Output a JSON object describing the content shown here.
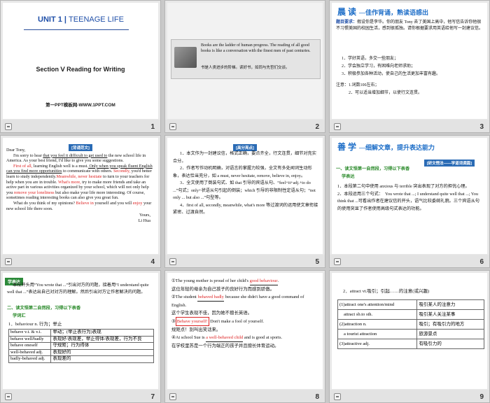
{
  "slides": [
    {
      "number": "1",
      "unit": "UNIT 1",
      "unit_title": "TEENAGE LIFE",
      "section": "Section Ⅴ Reading for Writing",
      "footer": "第一PPT模板网-WWW.1PPT.COM"
    },
    {
      "number": "2",
      "quote_en": "Books are the ladder of human progress. The reading of all good books is like a conversation with the finest men of past centuries.",
      "quote_cn": "书是人类进步的阶梯。读好书，如同与先哲们交谈。"
    },
    {
      "number": "3",
      "title_main": "晨 读",
      "title_sub": "—佳作背诵，熟读语感出",
      "task_label": "题目要求：",
      "task": "假设你是李华。你的朋友 Tony 去了美国上高中，他写信告诉你他很不习惯美国的校园生活，感到很孤独。请你根据要求用英语给他写一封建议信。",
      "points": [
        "1．学好英语，多交一些朋友；",
        "2．学会独立学习，有困难向老师求助；",
        "3．积极参加各种活动，使自己的生活更加丰富有趣。"
      ],
      "notes": [
        "注意：1.词数100左右；",
        "2．可以适当增加细节，以使行文连贯。"
      ]
    },
    {
      "number": "4",
      "tag": "[背诵范文]",
      "greeting": "Dear Tony,",
      "p1_a": "I'm sorry to hear ",
      "p1_u": "that you feel it difficult to get used to",
      "p1_b": " the new school life in America. As your best friend, I'd like to give you some suggestions.",
      "p2_a": "First of all,",
      "p2_b": " learning English well is a must.",
      "p2_u": " Only when you speak fluent English can you find more opportunities",
      "p2_c": " to communicate with others. ",
      "p2_d": "Secondly,",
      "p2_e": " you'd better learn to study independently.",
      "p2_f": "Meanwhile, never hesitate",
      "p2_g": " to turn to your teachers for help when you are in trouble. ",
      "p2_h": "What's more,",
      "p2_i": " try to make more friends and take an active part in various activities organized by your school, which will not only help you ",
      "p2_j": "remove your loneliness",
      "p2_k": " but also make your life more interesting. Of course, sometimes reading interesting books can also give you great fun.",
      "p3_a": "What do you think of my opinions? ",
      "p3_b": "Believe in",
      "p3_c": " yourself and you will ",
      "p3_d": "enjoy",
      "p3_e": " your new school life there soon.",
      "sign1": "Yours,",
      "sign2": "Li Hua"
    },
    {
      "number": "5",
      "tag": "[高分亮点]",
      "items": [
        "1．本文作为一封建议信，格式正确，要点齐全，行文连贯，细节对充实合分。",
        "2．作者写作动机明确，对语言的掌握力较强，全文有多处闻词生动形象，表达恰当充分，如 a must, never hesitate, remove, believe in, enjoy。",
        "3．全文使用了倒装句式、如 that 引导的宾语从句、“feel+it+adj.+to do ...”句式；only+状语从句引起的倒装；which 引导的非限制性定语从句；“not only ... but also ...”句型等。",
        "4．first of all, secondly, meanwhile, what's more 等过渡词的运用使文章衔接紧密、过渡自然。"
      ]
    },
    {
      "number": "6",
      "title_main": "善 学",
      "title_sub": "—细解文章，提升表达能力",
      "tag": "[研文悟法——学道词调篇]",
      "h1": "一、读文悟第一自然段，习得以下表香",
      "h2": "学表达",
      "items": [
        "1．本段第二句中使用 anxious 与 terrible 突出表现了对方的担忧心理。",
        "2．本段运用三个句式：　You wrote that ...; I understand quite well that ...; You think that ...可看出作者在建议信的开头，语气比较委婉礼貌。三个宾语从句的使用突显了作者使用高级句式表达的功能。"
      ]
    },
    {
      "number": "7",
      "tag": "学表达",
      "p1": "本段开头用“You wrote that ...”引出对方的问题，接着用“I understand quite well that ...”表达出自己对对方的理解。然后引出对方让作者解决的问题。",
      "h1": "二、读文悟第二自然段，习得以下表香",
      "h2": "学词汇",
      "word": "1．behaviour n. 行为；举止",
      "table": [
        [
          "behave v.t. & v.i.",
          "举动；(举止表行为)表现"
        ],
        [
          "behave well/badly",
          "表现好/表现差，举止得体/表现差，行为不良"
        ],
        [
          "behave oneself",
          "守规矩；行为得体"
        ],
        [
          "well-behaved adj.",
          "表现好的"
        ],
        [
          "badly-behaved adj.",
          "表现差的"
        ]
      ]
    },
    {
      "number": "8",
      "s1_a": "The young mother is proud of her child's ",
      "s1_b": "good behaviour",
      "s1_c": ".",
      "s1_cn": "这位年轻的母亲为自己孩子的良好行为而感到骄傲。",
      "s2_a": "The student ",
      "s2_b": "behaved badly",
      "s2_c": " because she didn't have a good command of English.",
      "s2_cn": "这个学生表现不佳，因为她不擅长英语。",
      "s3_b": "Behave yourself!",
      "s3_c": " Don't make a fool of yourself.",
      "s3_cn": "规矩点！别叫出笑话来。",
      "s4_a": "At school Sue is ",
      "s4_b": "a well-behaved child",
      "s4_c": " and is good at sports.",
      "s4_cn": "在学校里苏是一个行为端正的孩子并且擅长体育运动。"
    },
    {
      "number": "9",
      "head": "2．attract vt.吸引；引起……的注意(或兴趣)",
      "rows": [
        [
          "(1)attract one's attention/mind",
          "吸引某人的注意力"
        ],
        [
          "attract sb.to sth.",
          "吸引某人关注某事"
        ],
        [
          "(2)attraction n.",
          "吸引；有吸引力的地方"
        ],
        [
          "a tourist attraction",
          "旅游景点"
        ],
        [
          "(3)attractive adj.",
          "有吸引力的"
        ]
      ]
    }
  ]
}
